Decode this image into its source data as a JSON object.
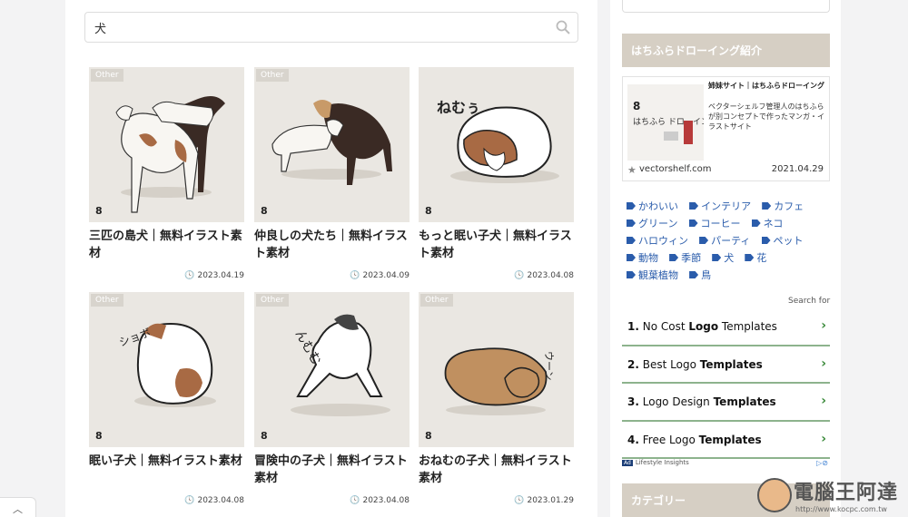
{
  "search": {
    "value": "犬"
  },
  "posts": [
    {
      "category": "Other",
      "title": "三匹の島犬｜無料イラスト素材",
      "date": "2023.04.19"
    },
    {
      "category": "Other",
      "title": "仲良しの犬たち｜無料イラスト素材",
      "date": "2023.04.09"
    },
    {
      "category": "Other",
      "title": "もっと眠い子犬｜無料イラスト素材",
      "date": "2023.04.08"
    },
    {
      "category": "Other",
      "title": "眠い子犬｜無料イラスト素材",
      "date": "2023.04.08"
    },
    {
      "category": "Other",
      "title": "冒険中の子犬｜無料イラスト素材",
      "date": "2023.04.08"
    },
    {
      "category": "Other",
      "title": "おねむの子犬｜無料イラスト素材",
      "date": "2023.01.29"
    }
  ],
  "illustration_text": {
    "nemu": "ねむぅ",
    "shobo": "ショボ",
    "nmumu": "んむむ",
    "un": "ウーン",
    "logo": "8"
  },
  "sidebar": {
    "intro_heading": "はちふらドローイング紹介",
    "sister_site": {
      "name": "姉妹サイト｜はちふらドローイング",
      "description": "ベクターシェルフ管理人のはちふらが別コンセプトで作ったマンガ・イラストサイト",
      "image_text": "はちふら ドローイング",
      "url": "vectorshelf.com",
      "date": "2021.04.29"
    },
    "tags": [
      [
        "かわいい",
        "インテリア",
        "カフェ"
      ],
      [
        "グリーン",
        "コーヒー",
        "ネコ"
      ],
      [
        "ハロウィン",
        "パーティ",
        "ペット"
      ],
      [
        "動物",
        "季節",
        "犬",
        "花"
      ],
      [
        "観葉植物",
        "鳥"
      ]
    ],
    "search_for_label": "Search for",
    "ads": [
      {
        "num": "1.",
        "pre": "No Cost ",
        "bold": "Logo",
        "post": " Templates"
      },
      {
        "num": "2.",
        "pre": "Best Logo ",
        "bold": "Templates",
        "post": ""
      },
      {
        "num": "3.",
        "pre": "Logo Design ",
        "bold": "Templates",
        "post": ""
      },
      {
        "num": "4.",
        "pre": "Free Logo ",
        "bold": "Templates",
        "post": ""
      }
    ],
    "ad_badge": "Ad",
    "ad_source": "Lifestyle Insights",
    "category_heading": "カテゴリー"
  },
  "watermark": {
    "text": "電腦王阿達",
    "url": "http://www.kocpc.com.tw"
  },
  "colors": {
    "accent_header": "#d6cfc4",
    "tag_blue": "#2a5cab",
    "ad_underline": "#8db38d",
    "thumb_bg": "#eae7e2"
  }
}
